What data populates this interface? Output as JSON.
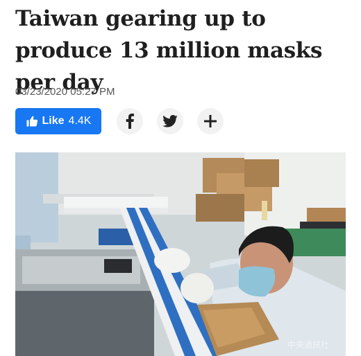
{
  "article": {
    "headline": "Taiwan gearing up to produce 13 million masks per day",
    "timestamp": "03/23/2020 05:27 PM"
  },
  "share": {
    "like_label": "Like",
    "like_count": "4.4K",
    "like_color": "#1877f2",
    "buttons": [
      {
        "name": "facebook",
        "icon": "facebook-f-icon"
      },
      {
        "name": "twitter",
        "icon": "twitter-bird-icon"
      },
      {
        "name": "more",
        "icon": "plus-icon"
      }
    ]
  },
  "photo": {
    "subject": "mask-production-line",
    "watermark": "中央通訊社"
  }
}
